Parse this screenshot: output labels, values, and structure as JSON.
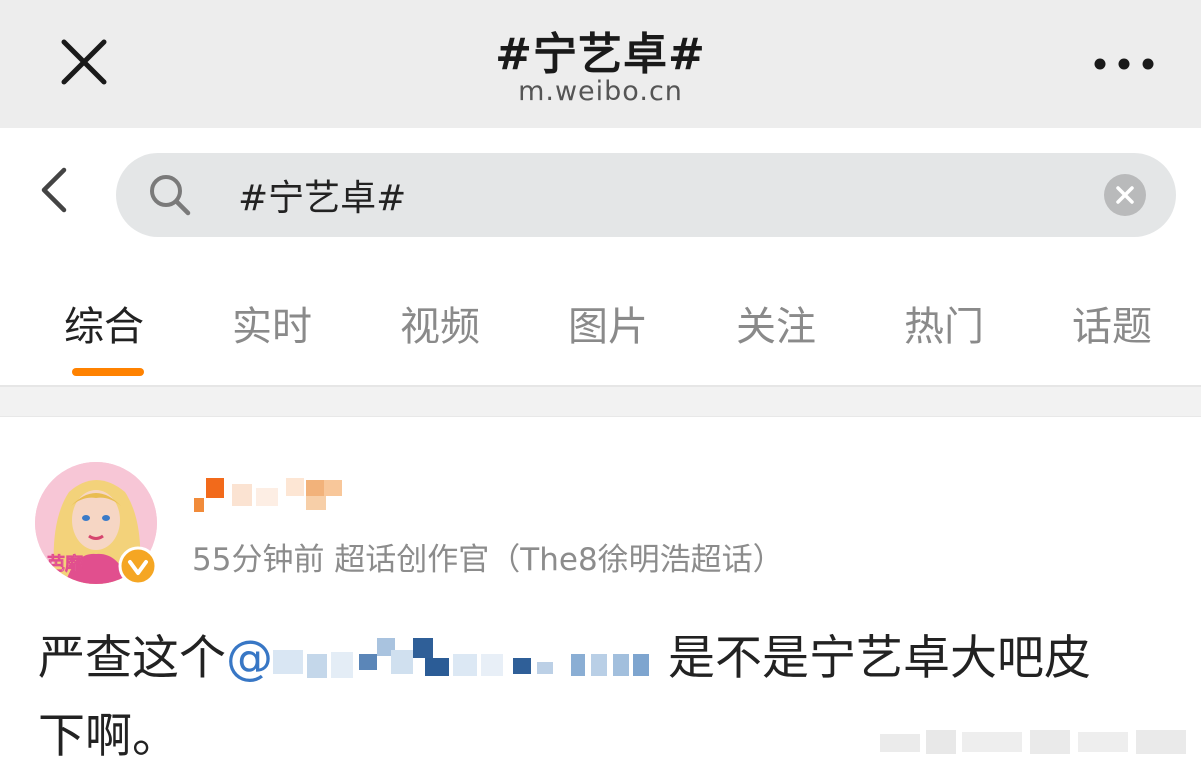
{
  "titlebar": {
    "title": "#宁艺卓#",
    "url": "m.weibo.cn"
  },
  "search": {
    "query": "#宁艺卓#"
  },
  "tabs": [
    {
      "label": "综合",
      "active": true
    },
    {
      "label": "实时",
      "active": false
    },
    {
      "label": "视频",
      "active": false
    },
    {
      "label": "图片",
      "active": false
    },
    {
      "label": "关注",
      "active": false
    },
    {
      "label": "热门",
      "active": false
    },
    {
      "label": "话题",
      "active": false
    }
  ],
  "post": {
    "avatar_label": "芭摩",
    "meta": "55分钟前 超话创作官（The8徐明浩超话）",
    "text_before": "严查这个",
    "mention_prefix": "@",
    "text_after": " 是不是宁艺卓大吧皮",
    "text_line2": "下啊。"
  },
  "colors": {
    "accent": "#ff8200",
    "link": "#3877c5",
    "titlebar_bg": "#ededed",
    "search_bg": "#e4e6e7"
  },
  "icons": [
    "close-icon",
    "more-icon",
    "back-icon",
    "search-icon",
    "clear-icon",
    "verified-icon"
  ]
}
